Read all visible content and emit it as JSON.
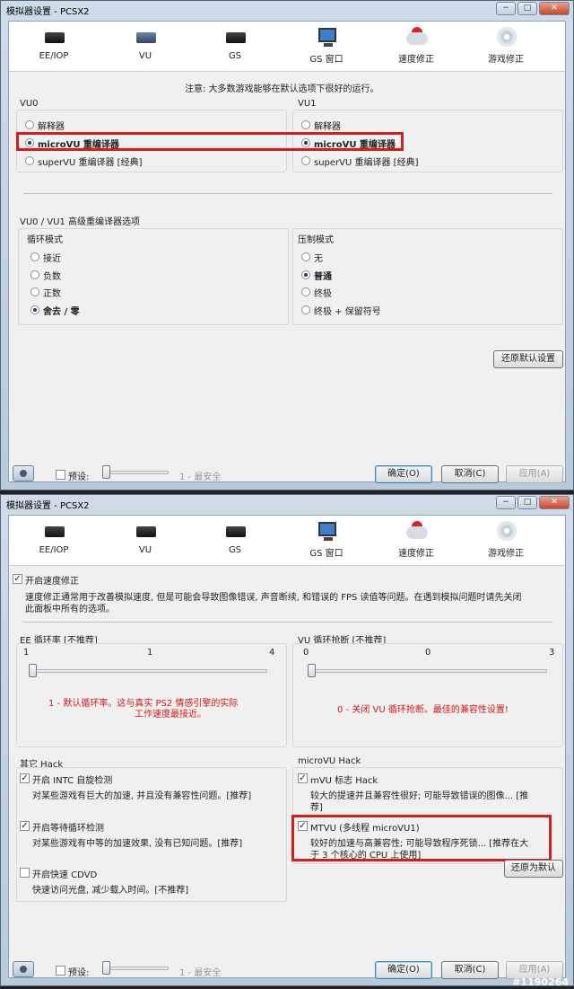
{
  "watermark": "#1190264",
  "tabs": [
    "EE/IOP",
    "VU",
    "GS",
    "GS 窗口",
    "速度修正",
    "游戏修正"
  ],
  "icons": [
    "chip-icon",
    "chip-blue-icon",
    "chip-icon",
    "monitor-icon",
    "cloud-icon",
    "disc-icon"
  ],
  "window_controls": [
    "−",
    "□",
    "✕"
  ],
  "footer": {
    "preset_label": "预设:",
    "preset_value": "1 - 最安全",
    "ok": "确定(O)",
    "cancel": "取消(C)",
    "apply": "应用(A)"
  },
  "win1": {
    "title": "模拟器设置 - PCSX2",
    "notice": "注意: 大多数游戏能够在默认选项下很好的运行。",
    "vu0": {
      "title": "VU0",
      "options": [
        "解释器",
        "microVU 重编译器",
        "superVU 重编译器 [经典]"
      ],
      "selected": 1
    },
    "vu1": {
      "title": "VU1",
      "options": [
        "解释器",
        "microVU 重编译器",
        "superVU 重编译器 [经典]"
      ],
      "selected": 1
    },
    "advanced_title": "VU0 / VU1 高级重编译器选项",
    "round": {
      "title": "循环模式",
      "options": [
        "接近",
        "负数",
        "正数",
        "舍去 / 零"
      ],
      "selected": 3
    },
    "clamp": {
      "title": "压制模式",
      "options": [
        "无",
        "普通",
        "终极",
        "终极 + 保留符号"
      ],
      "selected": 1
    },
    "restore_defaults": "还原默认设置"
  },
  "win2": {
    "title": "模拟器设置 - PCSX2",
    "enable_speedhacks": "开启速度修正",
    "enable_speedhacks_checked": true,
    "speedhacks_desc_1": "速度修正通常用于改善模拟速度, 但是可能会导致图像错误, 声音断续, 和错误的 FPS 读值等问题。在遇到模拟问题时请先关闭",
    "speedhacks_desc_2": "此面板中所有的选项。",
    "ee_cycle": {
      "title": "EE 循环率 [不推荐]",
      "ticks": [
        "1",
        "1",
        "4"
      ],
      "value": 1,
      "desc_1": "1 - 默认循环率。这与真实 PS2 情感引擎的实际",
      "desc_2": "工作速度最接近。"
    },
    "vu_cycle": {
      "title": "VU 循环抢断 [不推荐]",
      "ticks": [
        "0",
        "0",
        "3"
      ],
      "value": 0,
      "desc": "0 - 关闭 VU 循环抢断。最佳的兼容性设置!"
    },
    "other_title": "其它 Hack",
    "other": [
      {
        "label": "开启 INTC 自旋检测",
        "desc": "对某些游戏有巨大的加速, 并且没有兼容性问题。[推荐]",
        "checked": true
      },
      {
        "label": "开启等待循环检测",
        "desc": "对某些游戏有中等的加速效果, 没有已知问题。[推荐]",
        "checked": true
      },
      {
        "label": "开启快速 CDVD",
        "desc": "快速访问光盘, 减少载入时间。[不推荐]",
        "checked": false
      }
    ],
    "mvu_title": "microVU Hack",
    "mvu_flag": {
      "label": "mVU 标志 Hack",
      "desc_1": "较大的提速并且兼容性很好; 可能导致错误的图像... [推",
      "desc_2": "荐]",
      "checked": true
    },
    "mtvu": {
      "label": "MTVU (多线程 microVU1)",
      "desc_1": "较好的加速与高兼容性; 可能导致程序死锁... [推荐在大",
      "desc_2": "于 3 个核心的 CPU 上使用]",
      "checked": true
    },
    "restore_defaults": "还原为默认"
  }
}
